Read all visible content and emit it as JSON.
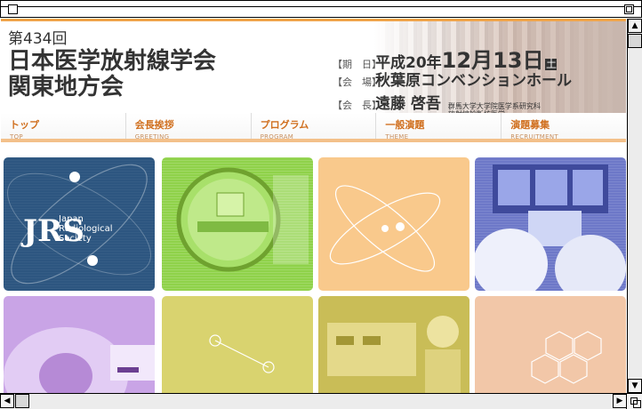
{
  "window": {
    "title": ""
  },
  "header": {
    "title_line1": "第434回",
    "title_line2": "日本医学放射線学会",
    "title_line3": "関東地方会",
    "date_label": "【期　日】",
    "date_prefix": "平成20年",
    "date_month_day": "12月13日",
    "date_dow": "土",
    "venue_label": "【会　場】",
    "venue": "秋葉原コンベンションホール",
    "president_label": "【会　長】",
    "president_name": "遠藤 啓吾",
    "president_affil_1": "群馬大学大学院医学系研究科",
    "president_affil_2": "放射線診断核医学"
  },
  "nav": [
    {
      "jp": "トップ",
      "en": "TOP"
    },
    {
      "jp": "会長挨拶",
      "en": "GREETING"
    },
    {
      "jp": "プログラム",
      "en": "PROGRAM"
    },
    {
      "jp": "一般演題",
      "en": "THEME"
    },
    {
      "jp": "演題募集",
      "en": "RECRUITMENT"
    }
  ],
  "tiles": {
    "jrs_logo_text_1": "Japan",
    "jrs_logo_text_2": "Radiological",
    "jrs_logo_text_3": "Society"
  },
  "scroll": {
    "up": "▲",
    "down": "▼",
    "left": "◀",
    "right": "▶"
  }
}
